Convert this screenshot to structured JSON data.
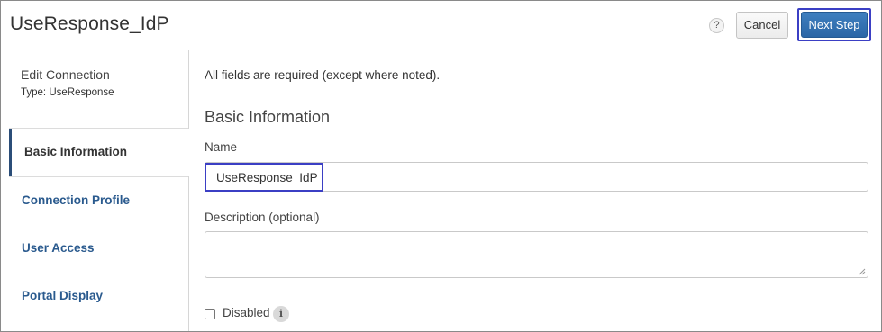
{
  "header": {
    "title": "UseResponse_IdP",
    "help_glyph": "?",
    "cancel_label": "Cancel",
    "next_label": "Next Step"
  },
  "sidebar": {
    "edit_label": "Edit Connection",
    "type_label": "Type: UseResponse",
    "items": [
      {
        "label": "Basic Information",
        "active": true
      },
      {
        "label": "Connection Profile",
        "active": false
      },
      {
        "label": "User Access",
        "active": false
      },
      {
        "label": "Portal Display",
        "active": false
      }
    ]
  },
  "main": {
    "note": "All fields are required (except where noted).",
    "section_title": "Basic Information",
    "name_label": "Name",
    "name_value": "UseResponse_IdP",
    "description_label": "Description (optional)",
    "description_value": "",
    "disabled_label": "Disabled",
    "disabled_checked": false,
    "info_glyph": "i"
  },
  "colors": {
    "accent": "#2a66a6",
    "highlight": "#3b3fc4",
    "link": "#2a5a8e"
  },
  "icons": [
    "help-icon",
    "info-icon",
    "resize-grip-icon"
  ]
}
